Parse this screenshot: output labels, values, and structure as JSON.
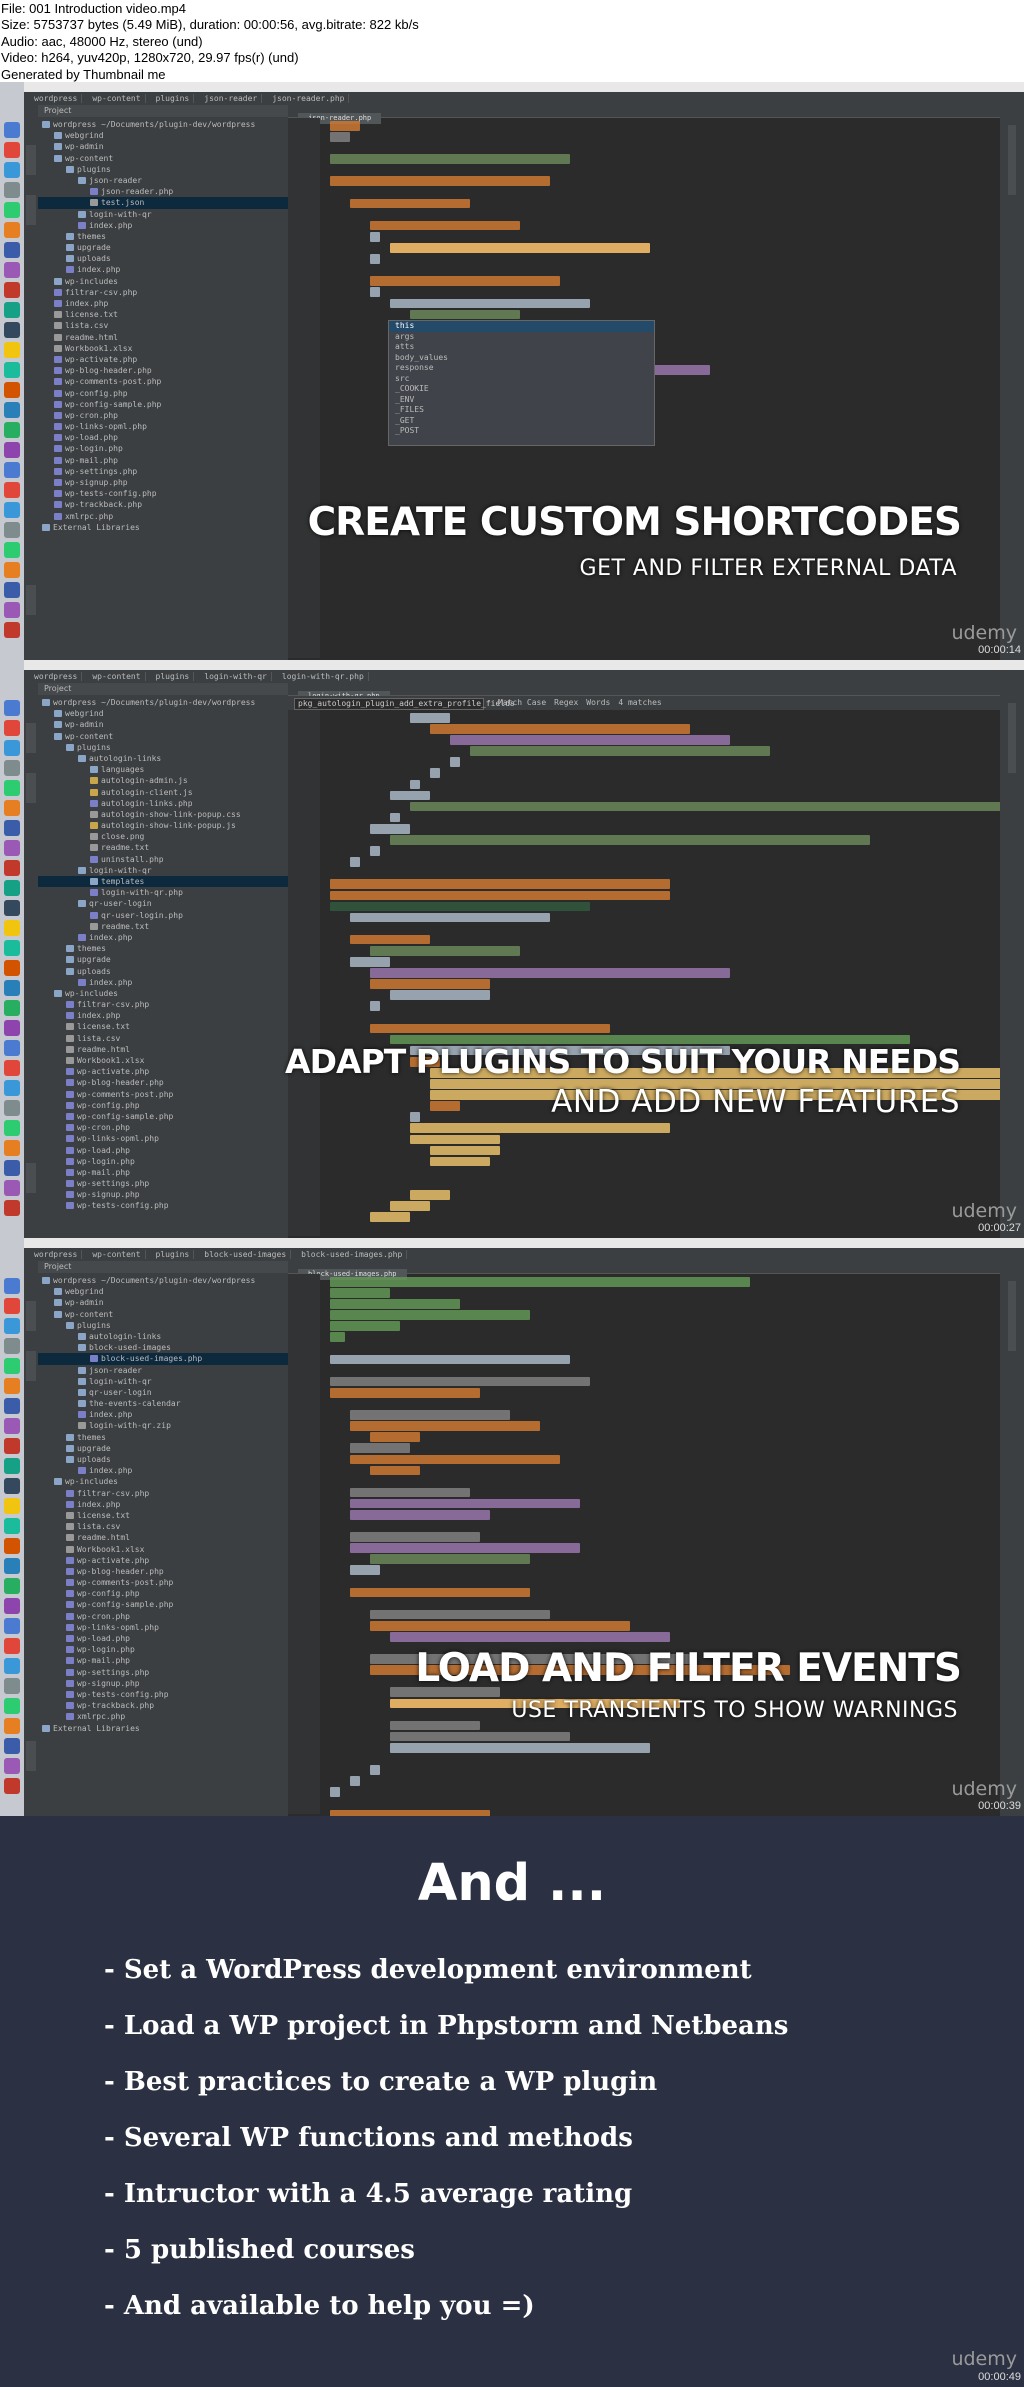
{
  "header": {
    "lines": [
      "File: 001 Introduction video.mp4",
      "Size: 5753737 bytes (5.49 MiB), duration: 00:00:56, avg.bitrate: 822 kb/s",
      "Audio: aac, 48000 Hz, stereo (und)",
      "Video: h264, yuv420p, 1280x720, 29.97 fps(r) (und)",
      "Generated by Thumbnail me"
    ]
  },
  "frames": [
    {
      "breadcrumbs": [
        "wordpress",
        "wp-content",
        "plugins",
        "json-reader",
        "json-reader.php"
      ],
      "project_label": "Project",
      "tab": "json-reader.php",
      "title": "CREATE CUSTOM SHORTCODES",
      "subtitle": "GET AND FILTER EXTERNAL DATA",
      "watermark": "udemy",
      "timestamp": "00:00:14",
      "tree": [
        "wordpress  ~/Documents/plugin-dev/wordpress",
        "webgrind",
        "wp-admin",
        "wp-content",
        "plugins",
        "json-reader",
        "json-reader.php",
        "test.json",
        "login-with-qr",
        "index.php",
        "themes",
        "upgrade",
        "uploads",
        "index.php",
        "wp-includes",
        "filtrar-csv.php",
        "index.php",
        "license.txt",
        "lista.csv",
        "readme.html",
        "Workbook1.xlsx",
        "wp-activate.php",
        "wp-blog-header.php",
        "wp-comments-post.php",
        "wp-config.php",
        "wp-config-sample.php",
        "wp-cron.php",
        "wp-links-opml.php",
        "wp-load.php",
        "wp-login.php",
        "wp-mail.php",
        "wp-settings.php",
        "wp-signup.php",
        "wp-tests-config.php",
        "wp-trackback.php",
        "xmlrpc.php",
        "External Libraries"
      ],
      "autocomplete": [
        "this",
        "args",
        "atts",
        "body_values",
        "response",
        "src",
        "_COOKIE",
        "_ENV",
        "_FILES",
        "_GET",
        "_POST"
      ]
    },
    {
      "breadcrumbs": [
        "wordpress",
        "wp-content",
        "plugins",
        "login-with-qr",
        "login-with-qr.php"
      ],
      "project_label": "Project",
      "tab": "login-with-qr.php",
      "find_query": "pkg_autologin_plugin_add_extra_profile_fields",
      "find_options": [
        "Match Case",
        "Regex",
        "Words",
        "4 matches"
      ],
      "title": "ADAPT PLUGINS TO SUIT YOUR NEEDS",
      "subtitle": "AND ADD NEW FEATURES",
      "watermark": "udemy",
      "timestamp": "00:00:27",
      "tree": [
        "wordpress  ~/Documents/plugin-dev/wordpress",
        "webgrind",
        "wp-admin",
        "wp-content",
        "plugins",
        "autologin-links",
        "languages",
        "autologin-admin.js",
        "autologin-client.js",
        "autologin-links.php",
        "autologin-show-link-popup.css",
        "autologin-show-link-popup.js",
        "close.png",
        "readme.txt",
        "uninstall.php",
        "login-with-qr",
        "templates",
        "login-with-qr.php",
        "qr-user-login",
        "qr-user-login.php",
        "readme.txt",
        "index.php",
        "themes",
        "upgrade",
        "uploads",
        "index.php",
        "wp-includes",
        "filtrar-csv.php",
        "index.php",
        "license.txt",
        "lista.csv",
        "readme.html",
        "Workbook1.xlsx",
        "wp-activate.php",
        "wp-blog-header.php",
        "wp-comments-post.php",
        "wp-config.php",
        "wp-config-sample.php",
        "wp-cron.php",
        "wp-links-opml.php",
        "wp-load.php",
        "wp-login.php",
        "wp-mail.php",
        "wp-settings.php",
        "wp-signup.php",
        "wp-tests-config.php"
      ]
    },
    {
      "breadcrumbs": [
        "wordpress",
        "wp-content",
        "plugins",
        "block-used-images",
        "block-used-images.php"
      ],
      "project_label": "Project",
      "tab": "block-used-images.php",
      "title": "LOAD AND FILTER EVENTS",
      "subtitle": "USE TRANSIENTS TO SHOW WARNINGS",
      "watermark": "udemy",
      "timestamp": "00:00:39",
      "tree": [
        "wordpress  ~/Documents/plugin-dev/wordpress",
        "webgrind",
        "wp-admin",
        "wp-content",
        "plugins",
        "autologin-links",
        "block-used-images",
        "block-used-images.php",
        "json-reader",
        "login-with-qr",
        "qr-user-login",
        "the-events-calendar",
        "index.php",
        "login-with-qr.zip",
        "themes",
        "upgrade",
        "uploads",
        "index.php",
        "wp-includes",
        "filtrar-csv.php",
        "index.php",
        "license.txt",
        "lista.csv",
        "readme.html",
        "Workbook1.xlsx",
        "wp-activate.php",
        "wp-blog-header.php",
        "wp-comments-post.php",
        "wp-config.php",
        "wp-config-sample.php",
        "wp-cron.php",
        "wp-links-opml.php",
        "wp-load.php",
        "wp-login.php",
        "wp-mail.php",
        "wp-settings.php",
        "wp-signup.php",
        "wp-tests-config.php",
        "wp-trackback.php",
        "xmlrpc.php",
        "External Libraries"
      ]
    }
  ],
  "summary": {
    "heading": "And ...",
    "items": [
      "- Set a WordPress development environment",
      "- Load a WP project in Phpstorm and Netbeans",
      "- Best practices to create a WP plugin",
      "- Several WP functions and methods",
      "- Intructor with a 4.5 average rating",
      "- 5 published courses",
      "- And available to help you =)"
    ],
    "watermark": "udemy",
    "timestamp": "00:00:49"
  },
  "colors": {
    "background": "#2b3142",
    "ide": "#2b2b2b",
    "panel": "#3c3f41",
    "selection": "#0d293e"
  }
}
